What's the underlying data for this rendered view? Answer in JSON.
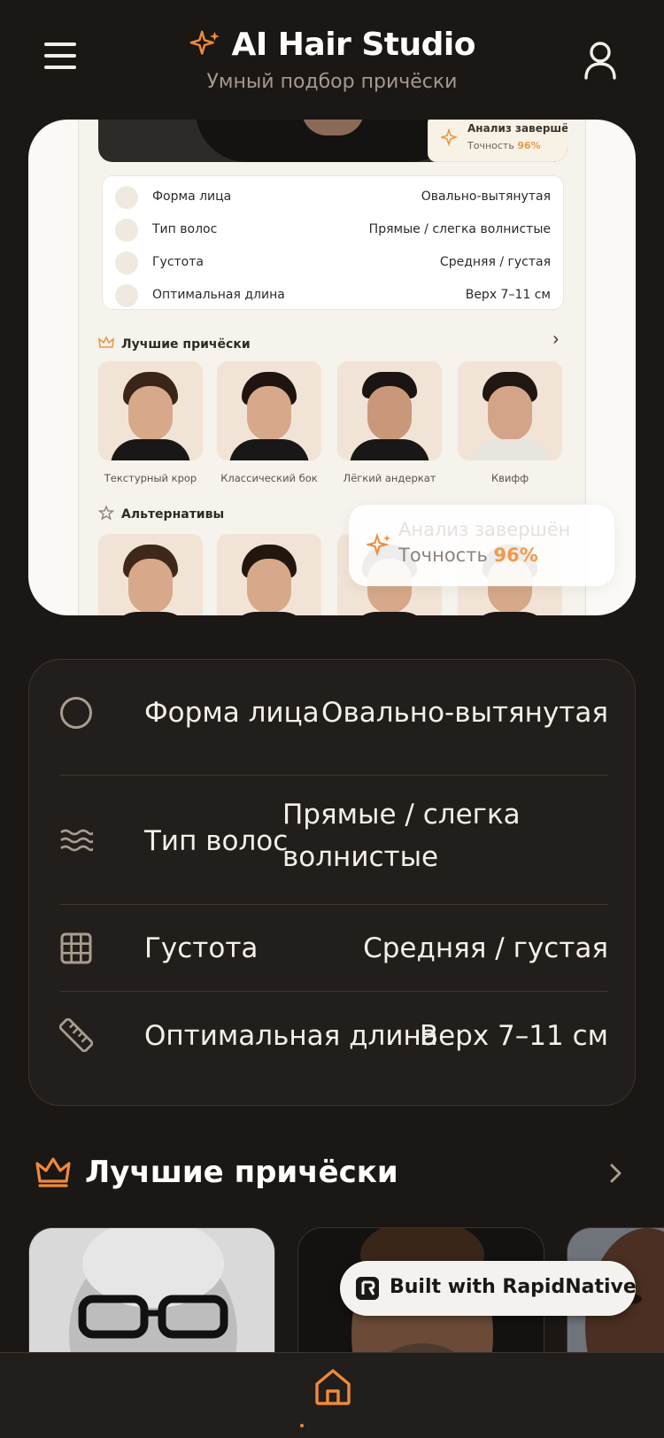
{
  "header": {
    "title": "AI Hair Studio",
    "subtitle": "Умный подбор причёски"
  },
  "hero": {
    "mini_badge_title": "Анализ завершён",
    "mini_badge_accuracy_label": "Точность",
    "mini_badge_accuracy_value": "96%",
    "mini_rows": [
      {
        "label": "Форма лица",
        "value": "Овально-вытянутая"
      },
      {
        "label": "Тип волос",
        "value": "Прямые / слегка волнистые"
      },
      {
        "label": "Густота",
        "value": "Средняя / густая"
      },
      {
        "label": "Оптимальная длина",
        "value": "Верх 7–11 см"
      }
    ],
    "best_title": "Лучшие причёски",
    "best_items": [
      "Текстурный крор",
      "Классический бок",
      "Лёгкий андеркат",
      "Квифф"
    ],
    "alt_title": "Альтернативы",
    "toast_ghost": "Анализ завершён",
    "toast_accuracy_label": "Точность",
    "toast_accuracy_value": "96%"
  },
  "analysis": {
    "rows": [
      {
        "icon": "circle-icon",
        "label": "Форма лица",
        "value": "Овально-вытянутая"
      },
      {
        "icon": "waves-icon",
        "label": "Тип волос",
        "value": "Прямые / слегка волнистые"
      },
      {
        "icon": "grid-icon",
        "label": "Густота",
        "value": "Средняя / густая"
      },
      {
        "icon": "ruler-icon",
        "label": "Оптимальная длина",
        "value": "Верх 7–11 см"
      }
    ]
  },
  "best_section": {
    "title": "Лучшие причёски"
  },
  "rapid_badge": {
    "label": "Built with RapidNative"
  },
  "colors": {
    "background": "#1b1715",
    "card": "#221e1b",
    "accent": "#ef8a3a"
  }
}
